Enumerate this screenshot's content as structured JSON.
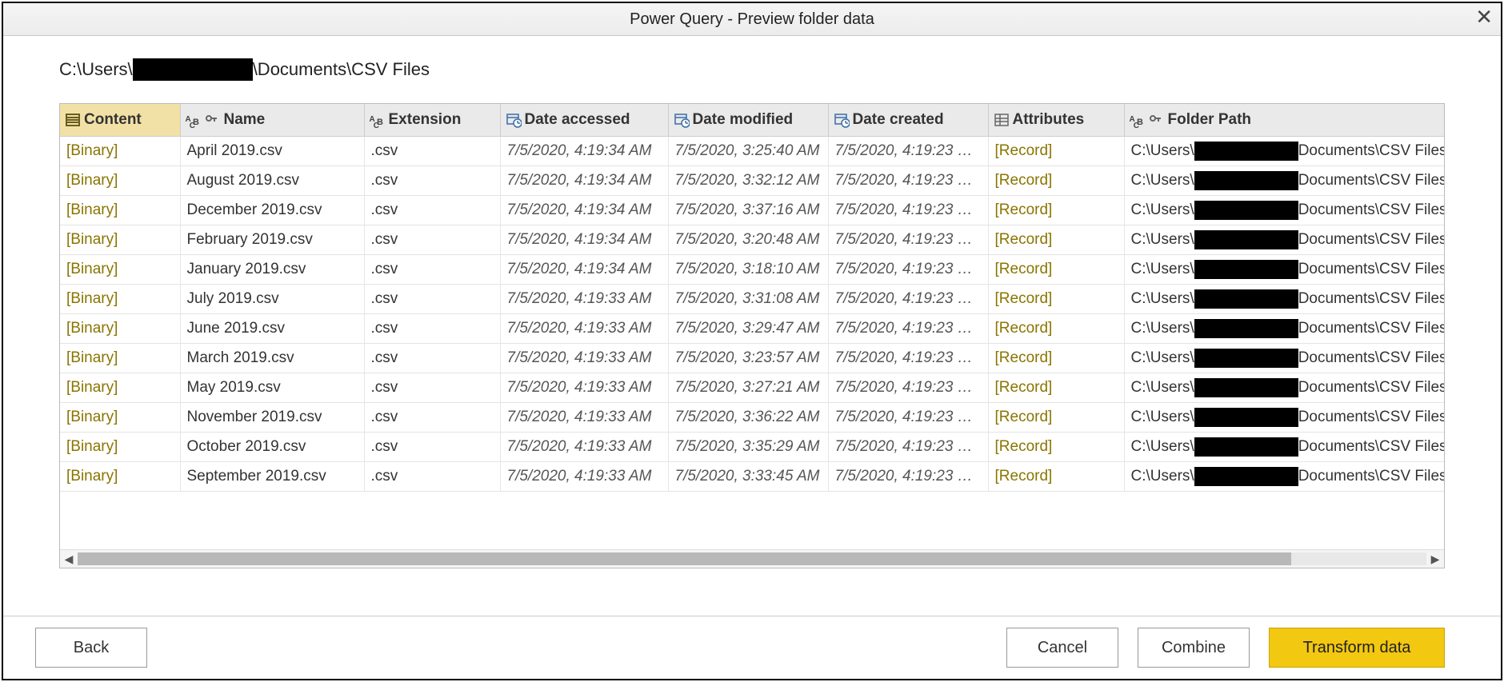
{
  "title": "Power Query - Preview folder data",
  "path_prefix": "C:\\Users\\",
  "path_suffix": "\\Documents\\CSV Files",
  "columns": {
    "content": "Content",
    "name": "Name",
    "ext": "Extension",
    "acc": "Date accessed",
    "mod": "Date modified",
    "crt": "Date created",
    "attr": "Attributes",
    "path": "Folder Path"
  },
  "cell_folder_prefix": "C:\\Users\\",
  "cell_folder_suffix": "Documents\\CSV Files\\",
  "rows": [
    {
      "content": "[Binary]",
      "name": "April 2019.csv",
      "ext": ".csv",
      "acc": "7/5/2020, 4:19:34 AM",
      "mod": "7/5/2020, 3:25:40 AM",
      "crt": "7/5/2020, 4:19:23 …",
      "attr": "[Record]"
    },
    {
      "content": "[Binary]",
      "name": "August 2019.csv",
      "ext": ".csv",
      "acc": "7/5/2020, 4:19:34 AM",
      "mod": "7/5/2020, 3:32:12 AM",
      "crt": "7/5/2020, 4:19:23 …",
      "attr": "[Record]"
    },
    {
      "content": "[Binary]",
      "name": "December 2019.csv",
      "ext": ".csv",
      "acc": "7/5/2020, 4:19:34 AM",
      "mod": "7/5/2020, 3:37:16 AM",
      "crt": "7/5/2020, 4:19:23 …",
      "attr": "[Record]"
    },
    {
      "content": "[Binary]",
      "name": "February 2019.csv",
      "ext": ".csv",
      "acc": "7/5/2020, 4:19:34 AM",
      "mod": "7/5/2020, 3:20:48 AM",
      "crt": "7/5/2020, 4:19:23 …",
      "attr": "[Record]"
    },
    {
      "content": "[Binary]",
      "name": "January 2019.csv",
      "ext": ".csv",
      "acc": "7/5/2020, 4:19:34 AM",
      "mod": "7/5/2020, 3:18:10 AM",
      "crt": "7/5/2020, 4:19:23 …",
      "attr": "[Record]"
    },
    {
      "content": "[Binary]",
      "name": "July 2019.csv",
      "ext": ".csv",
      "acc": "7/5/2020, 4:19:33 AM",
      "mod": "7/5/2020, 3:31:08 AM",
      "crt": "7/5/2020, 4:19:23 …",
      "attr": "[Record]"
    },
    {
      "content": "[Binary]",
      "name": "June 2019.csv",
      "ext": ".csv",
      "acc": "7/5/2020, 4:19:33 AM",
      "mod": "7/5/2020, 3:29:47 AM",
      "crt": "7/5/2020, 4:19:23 …",
      "attr": "[Record]"
    },
    {
      "content": "[Binary]",
      "name": "March 2019.csv",
      "ext": ".csv",
      "acc": "7/5/2020, 4:19:33 AM",
      "mod": "7/5/2020, 3:23:57 AM",
      "crt": "7/5/2020, 4:19:23 …",
      "attr": "[Record]"
    },
    {
      "content": "[Binary]",
      "name": "May 2019.csv",
      "ext": ".csv",
      "acc": "7/5/2020, 4:19:33 AM",
      "mod": "7/5/2020, 3:27:21 AM",
      "crt": "7/5/2020, 4:19:23 …",
      "attr": "[Record]"
    },
    {
      "content": "[Binary]",
      "name": "November 2019.csv",
      "ext": ".csv",
      "acc": "7/5/2020, 4:19:33 AM",
      "mod": "7/5/2020, 3:36:22 AM",
      "crt": "7/5/2020, 4:19:23 …",
      "attr": "[Record]"
    },
    {
      "content": "[Binary]",
      "name": "October 2019.csv",
      "ext": ".csv",
      "acc": "7/5/2020, 4:19:33 AM",
      "mod": "7/5/2020, 3:35:29 AM",
      "crt": "7/5/2020, 4:19:23 …",
      "attr": "[Record]"
    },
    {
      "content": "[Binary]",
      "name": "September 2019.csv",
      "ext": ".csv",
      "acc": "7/5/2020, 4:19:33 AM",
      "mod": "7/5/2020, 3:33:45 AM",
      "crt": "7/5/2020, 4:19:23 …",
      "attr": "[Record]"
    }
  ],
  "buttons": {
    "back": "Back",
    "cancel": "Cancel",
    "combine": "Combine",
    "transform": "Transform data"
  }
}
